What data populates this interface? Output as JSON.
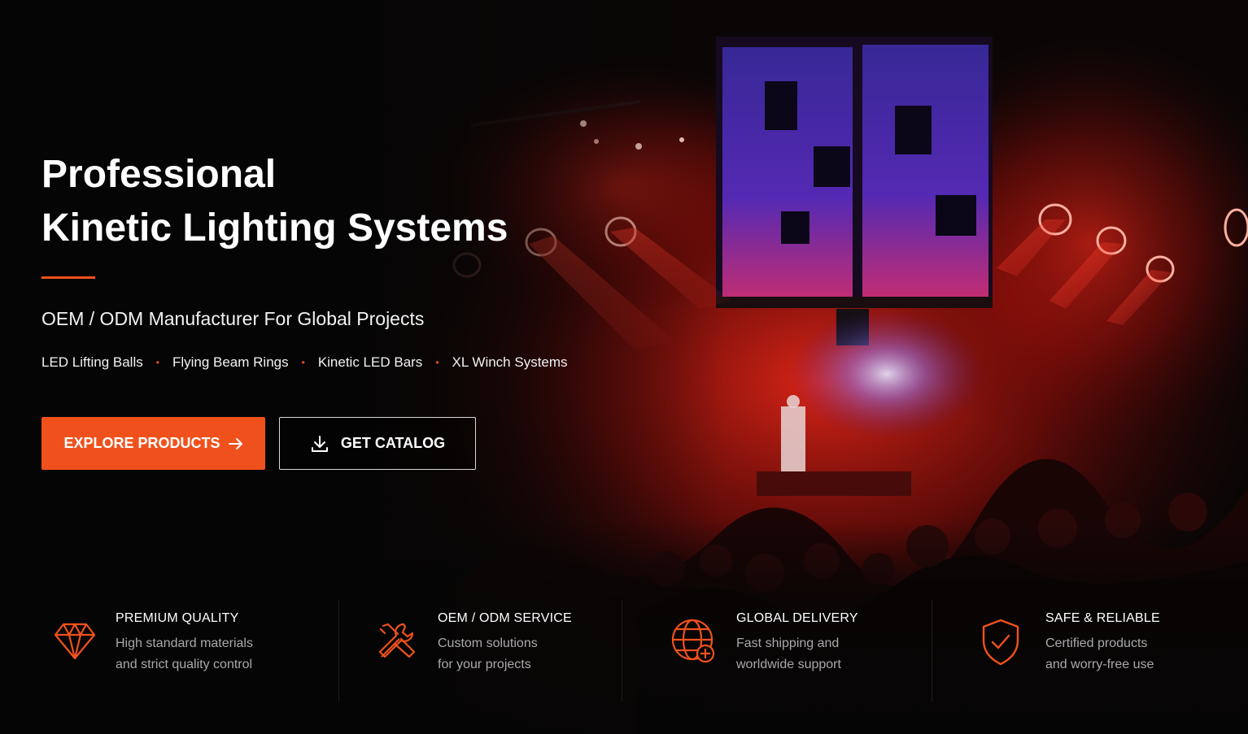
{
  "hero": {
    "title_line1": "Professional",
    "title_line2": "Kinetic Lighting Systems",
    "subtitle": "OEM / ODM Manufacturer For Global Projects",
    "tags": [
      "LED Lifting Balls",
      "Flying Beam Rings",
      "Kinetic LED Bars",
      "XL Winch Systems"
    ],
    "tag_separator": "•",
    "primary_button": "EXPLORE PRODUCTS",
    "secondary_button": "GET CATALOG"
  },
  "features": [
    {
      "icon": "diamond-icon",
      "title": "PREMIUM QUALITY",
      "desc1": "High standard materials",
      "desc2": "and strict quality control"
    },
    {
      "icon": "tools-icon",
      "title": "OEM / ODM SERVICE",
      "desc1": "Custom solutions",
      "desc2": "for your projects"
    },
    {
      "icon": "globe-icon",
      "title": "GLOBAL DELIVERY",
      "desc1": "Fast shipping and",
      "desc2": "worldwide support"
    },
    {
      "icon": "shield-check-icon",
      "title": "SAFE & RELIABLE",
      "desc1": "Certified products",
      "desc2": "and worry-free use"
    }
  ],
  "colors": {
    "accent": "#f0511c",
    "background": "#060505",
    "text_muted": "#a9a9a9"
  }
}
